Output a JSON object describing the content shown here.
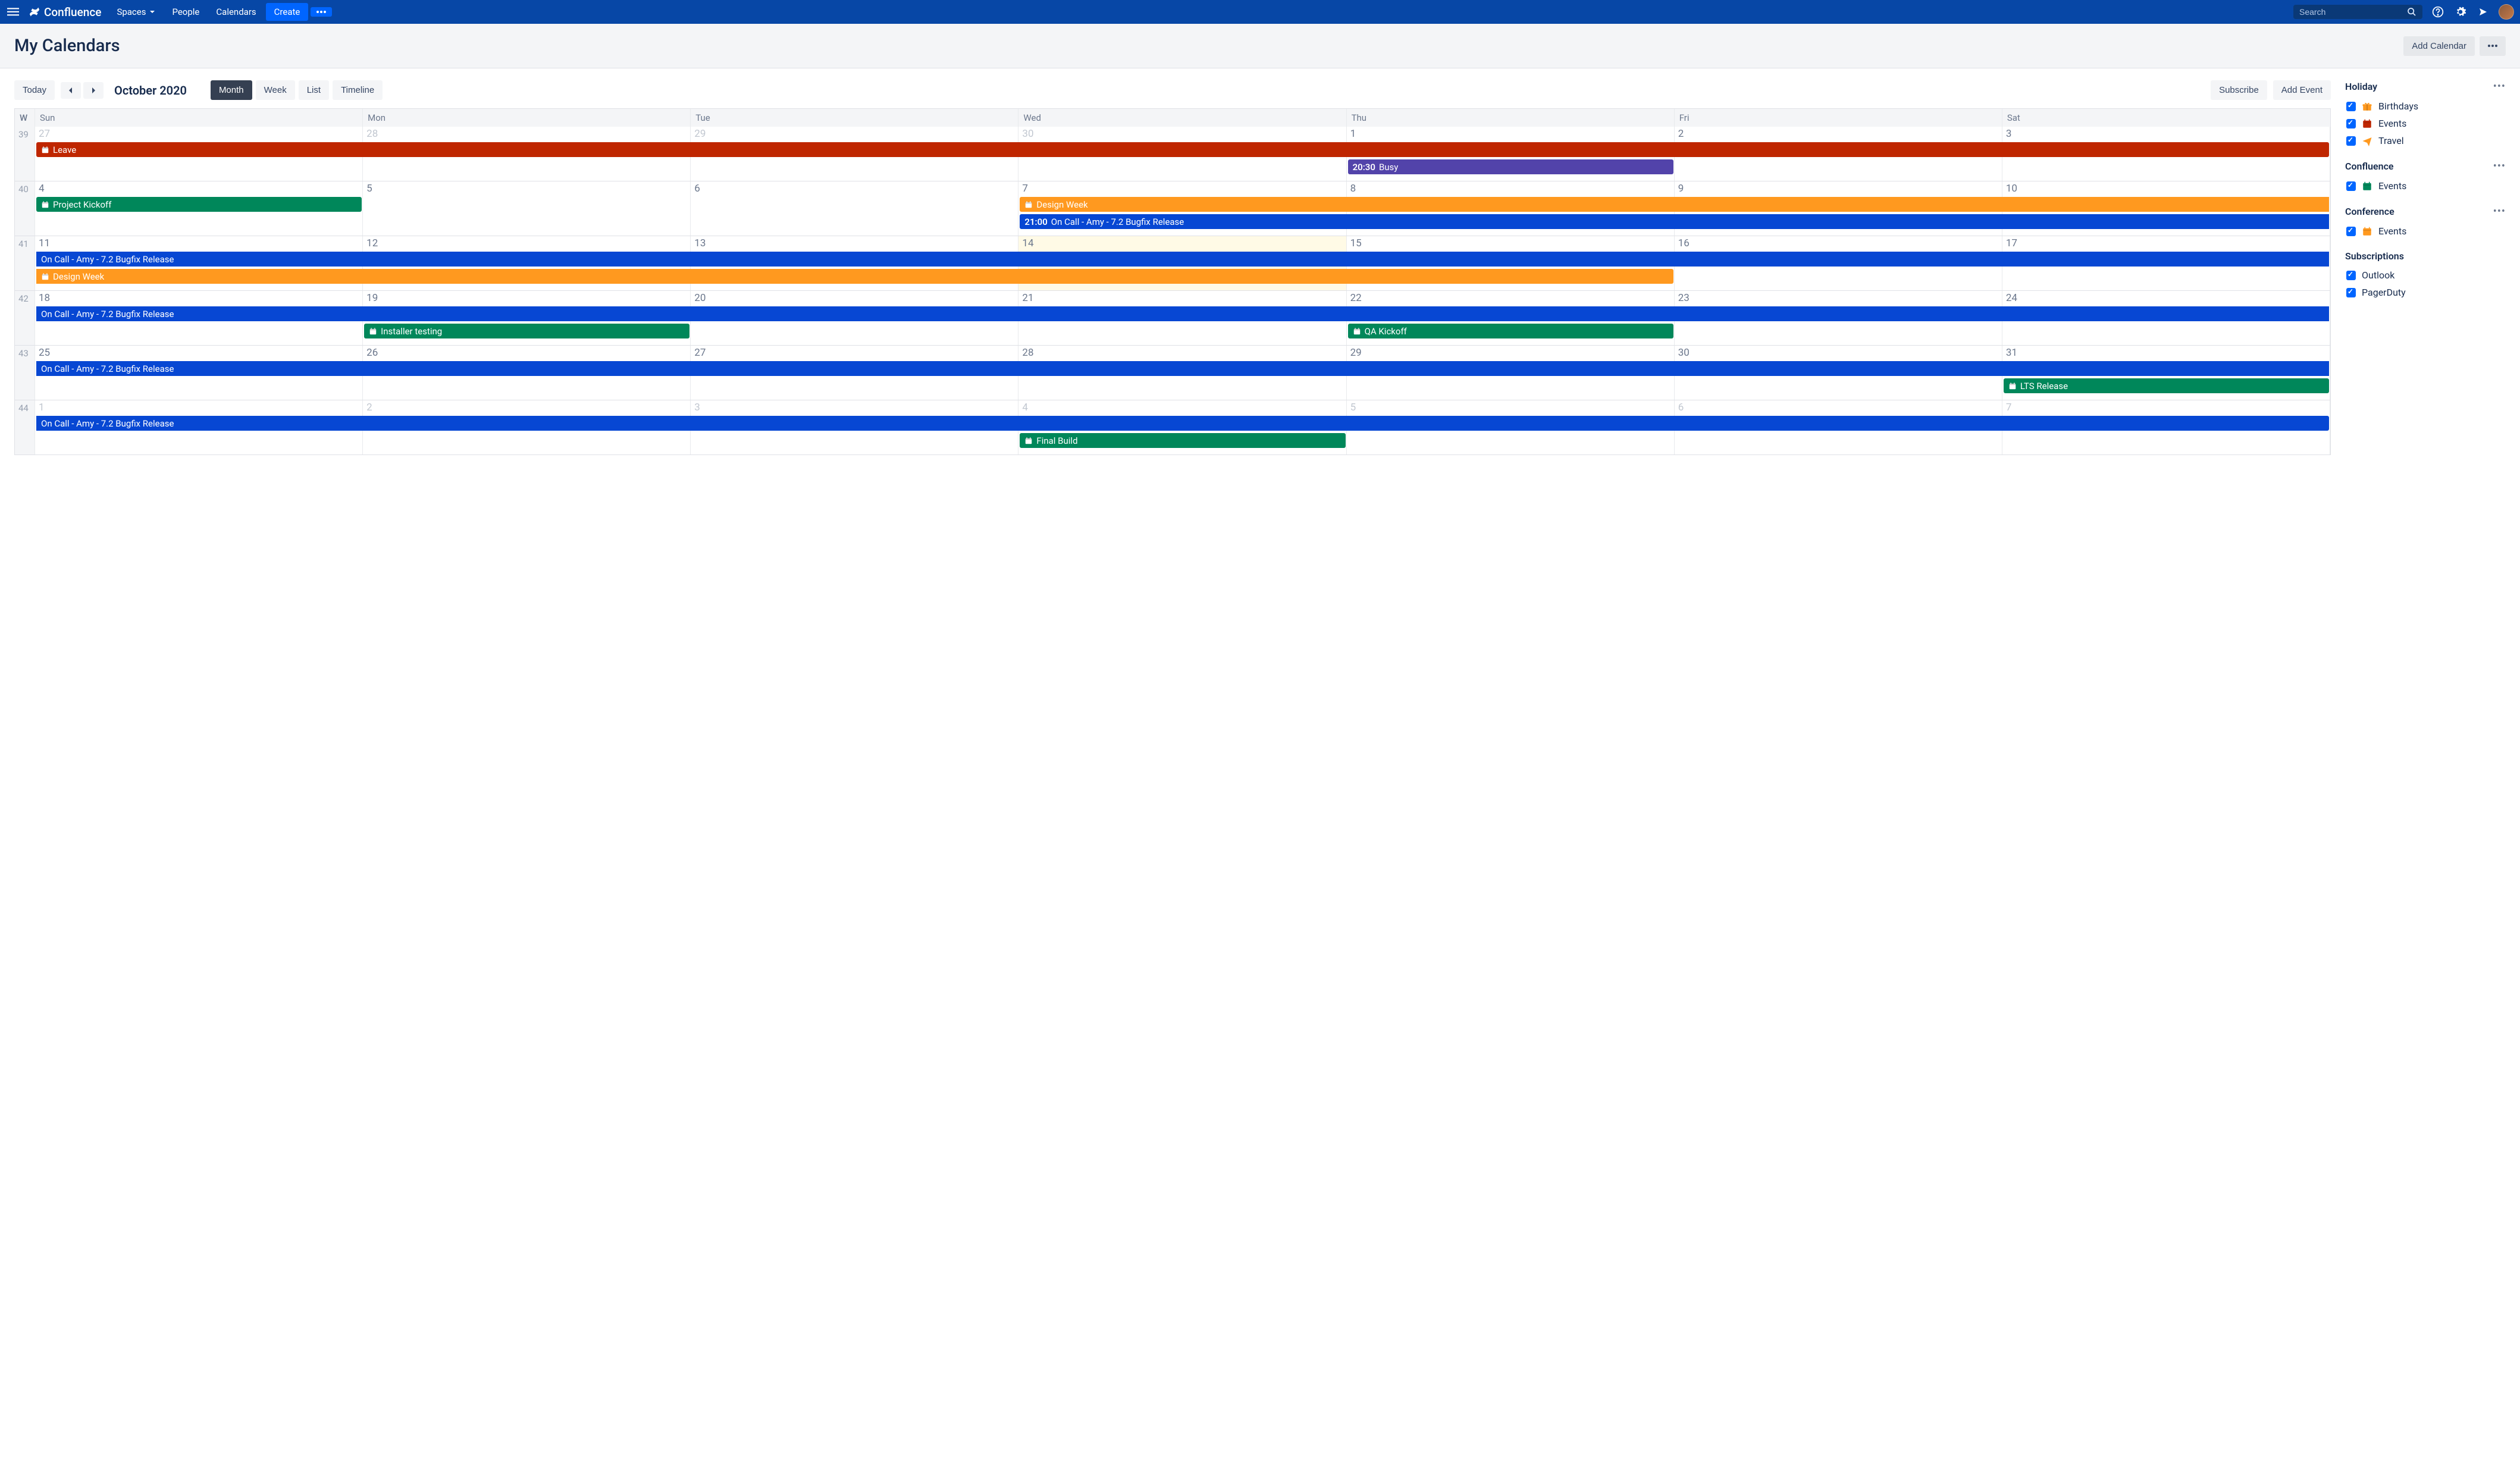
{
  "nav": {
    "brand": "Confluence",
    "spaces": "Spaces",
    "people": "People",
    "calendars": "Calendars",
    "create": "Create",
    "search_placeholder": "Search"
  },
  "header": {
    "title": "My Calendars",
    "add_calendar": "Add Calendar"
  },
  "toolbar": {
    "today": "Today",
    "month_label": "October 2020",
    "views": {
      "month": "Month",
      "week": "Week",
      "list": "List",
      "timeline": "Timeline"
    },
    "subscribe": "Subscribe",
    "add_event": "Add Event"
  },
  "calendar": {
    "week_header": "W",
    "day_headers": [
      "Sun",
      "Mon",
      "Tue",
      "Wed",
      "Thu",
      "Fri",
      "Sat"
    ],
    "weeks": [
      {
        "wk": "39",
        "days": [
          {
            "n": "27",
            "other": true
          },
          {
            "n": "28",
            "other": true
          },
          {
            "n": "29",
            "other": true
          },
          {
            "n": "30",
            "other": true
          },
          {
            "n": "1"
          },
          {
            "n": "2"
          },
          {
            "n": "3"
          }
        ]
      },
      {
        "wk": "40",
        "days": [
          {
            "n": "4"
          },
          {
            "n": "5"
          },
          {
            "n": "6"
          },
          {
            "n": "7"
          },
          {
            "n": "8"
          },
          {
            "n": "9"
          },
          {
            "n": "10"
          }
        ]
      },
      {
        "wk": "41",
        "days": [
          {
            "n": "11"
          },
          {
            "n": "12"
          },
          {
            "n": "13"
          },
          {
            "n": "14",
            "today": true
          },
          {
            "n": "15"
          },
          {
            "n": "16"
          },
          {
            "n": "17"
          }
        ]
      },
      {
        "wk": "42",
        "days": [
          {
            "n": "18"
          },
          {
            "n": "19"
          },
          {
            "n": "20"
          },
          {
            "n": "21"
          },
          {
            "n": "22"
          },
          {
            "n": "23"
          },
          {
            "n": "24"
          }
        ]
      },
      {
        "wk": "43",
        "days": [
          {
            "n": "25"
          },
          {
            "n": "26"
          },
          {
            "n": "27"
          },
          {
            "n": "28"
          },
          {
            "n": "29"
          },
          {
            "n": "30"
          },
          {
            "n": "31"
          }
        ]
      },
      {
        "wk": "44",
        "days": [
          {
            "n": "1",
            "other": true
          },
          {
            "n": "2",
            "other": true
          },
          {
            "n": "3",
            "other": true
          },
          {
            "n": "4",
            "other": true
          },
          {
            "n": "5",
            "other": true
          },
          {
            "n": "6",
            "other": true
          },
          {
            "n": "7",
            "other": true
          }
        ]
      }
    ],
    "events": [
      {
        "row": 0,
        "track": 0,
        "start": 0,
        "span": 7,
        "color": "red",
        "icon": true,
        "label": "Leave",
        "noround_l": false,
        "noround_r": false
      },
      {
        "row": 0,
        "track": 1,
        "start": 4,
        "span": 1,
        "color": "purple",
        "time": "20:30",
        "label": "Busy"
      },
      {
        "row": 1,
        "track": 0,
        "start": 0,
        "span": 1,
        "color": "green",
        "icon": true,
        "label": "Project Kickoff"
      },
      {
        "row": 1,
        "track": 0,
        "start": 3,
        "span": 4,
        "color": "orange",
        "icon": true,
        "label": "Design Week",
        "noround_r": true
      },
      {
        "row": 1,
        "track": 1,
        "start": 3,
        "span": 4,
        "color": "blue",
        "time": "21:00",
        "label": "On Call - Amy - 7.2 Bugfix Release",
        "noround_r": true
      },
      {
        "row": 2,
        "track": 0,
        "start": 0,
        "span": 7,
        "color": "blue",
        "label": "On Call - Amy - 7.2 Bugfix Release",
        "noround_l": true,
        "noround_r": true
      },
      {
        "row": 2,
        "track": 1,
        "start": 0,
        "span": 5,
        "color": "orange",
        "icon": true,
        "label": "Design Week",
        "noround_l": true
      },
      {
        "row": 3,
        "track": 0,
        "start": 0,
        "span": 7,
        "color": "blue",
        "label": "On Call - Amy - 7.2 Bugfix Release",
        "noround_l": true,
        "noround_r": true
      },
      {
        "row": 3,
        "track": 1,
        "start": 1,
        "span": 1,
        "color": "green",
        "icon": true,
        "label": "Installer testing"
      },
      {
        "row": 3,
        "track": 1,
        "start": 4,
        "span": 1,
        "color": "green",
        "icon": true,
        "label": "QA Kickoff"
      },
      {
        "row": 4,
        "track": 0,
        "start": 0,
        "span": 7,
        "color": "blue",
        "label": "On Call - Amy - 7.2 Bugfix Release",
        "noround_l": true,
        "noround_r": true
      },
      {
        "row": 4,
        "track": 1,
        "start": 6,
        "span": 1,
        "color": "green",
        "icon": true,
        "label": "LTS Release"
      },
      {
        "row": 5,
        "track": 0,
        "start": 0,
        "span": 7,
        "color": "blue",
        "label": "On Call - Amy - 7.2 Bugfix Release",
        "noround_l": true,
        "noround_r": false
      },
      {
        "row": 5,
        "track": 1,
        "start": 3,
        "span": 1,
        "color": "green",
        "icon": true,
        "label": "Final Build"
      }
    ]
  },
  "sidebar": {
    "sections": [
      {
        "title": "Holiday",
        "dots": true,
        "items": [
          {
            "label": "Birthdays",
            "icon": "gift",
            "color": "#ff991f"
          },
          {
            "label": "Events",
            "icon": "cal",
            "color": "#bf2600"
          },
          {
            "label": "Travel",
            "icon": "plane",
            "color": "#ff991f"
          }
        ]
      },
      {
        "title": "Confluence",
        "dots": true,
        "items": [
          {
            "label": "Events",
            "icon": "cal",
            "color": "#00875a"
          }
        ]
      },
      {
        "title": "Conference",
        "dots": true,
        "items": [
          {
            "label": "Events",
            "icon": "cal",
            "color": "#ff991f"
          }
        ]
      },
      {
        "title": "Subscriptions",
        "dots": false,
        "items": [
          {
            "label": "Outlook"
          },
          {
            "label": "PagerDuty"
          }
        ]
      }
    ]
  }
}
